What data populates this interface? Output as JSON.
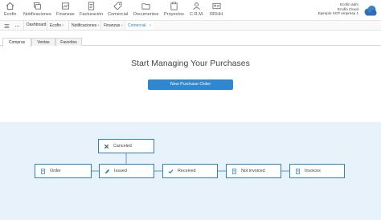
{
  "nav": {
    "items": [
      {
        "label": "Ecofin",
        "icon": "home-icon"
      },
      {
        "label": "Notificaciones",
        "icon": "bell-icon"
      },
      {
        "label": "Finanzas",
        "icon": "finance-icon"
      },
      {
        "label": "Facturación",
        "icon": "invoice-icon"
      },
      {
        "label": "Comercial",
        "icon": "tag-icon"
      },
      {
        "label": "Documentos",
        "icon": "folder-icon"
      },
      {
        "label": "Proyectos",
        "icon": "clipboard-icon"
      },
      {
        "label": "C.R.M.",
        "icon": "contacts-icon"
      },
      {
        "label": "RRHH",
        "icon": "id-card-icon"
      }
    ],
    "user": {
      "name": "Ecofin adm",
      "company": "Ecofin Cloud",
      "entity": "Ejemplo SCP empresa 1"
    }
  },
  "tabbar": {
    "tabs": [
      {
        "label": "Dashboard",
        "closable": false
      },
      {
        "label": "Ecofin",
        "closable": true
      },
      {
        "label": "Notificaciones",
        "closable": true
      },
      {
        "label": "Finanzas",
        "closable": true
      },
      {
        "label": "Comercial",
        "closable": true,
        "active": true
      }
    ],
    "close_glyph": "×"
  },
  "subtabs": [
    {
      "label": "Compras",
      "active": true
    },
    {
      "label": "Ventas",
      "active": false
    },
    {
      "label": "Favoritos",
      "active": false
    }
  ],
  "main": {
    "title": "Start Managing Your Purchases",
    "cta_label": "New Purchase Order"
  },
  "flow": {
    "nodes": [
      {
        "label": "Canceled",
        "icon": "cross-icon"
      },
      {
        "label": "Order",
        "icon": "document-icon"
      },
      {
        "label": "Issued",
        "icon": "pencil-icon"
      },
      {
        "label": "Received",
        "icon": "check-icon"
      },
      {
        "label": "Not invoiced",
        "icon": "document-icon"
      },
      {
        "label": "Invoices",
        "icon": "document-icon"
      }
    ]
  },
  "colors": {
    "accent": "#2d84c4",
    "button": "#2d87d1",
    "flow_bg": "#e8f2fb"
  }
}
